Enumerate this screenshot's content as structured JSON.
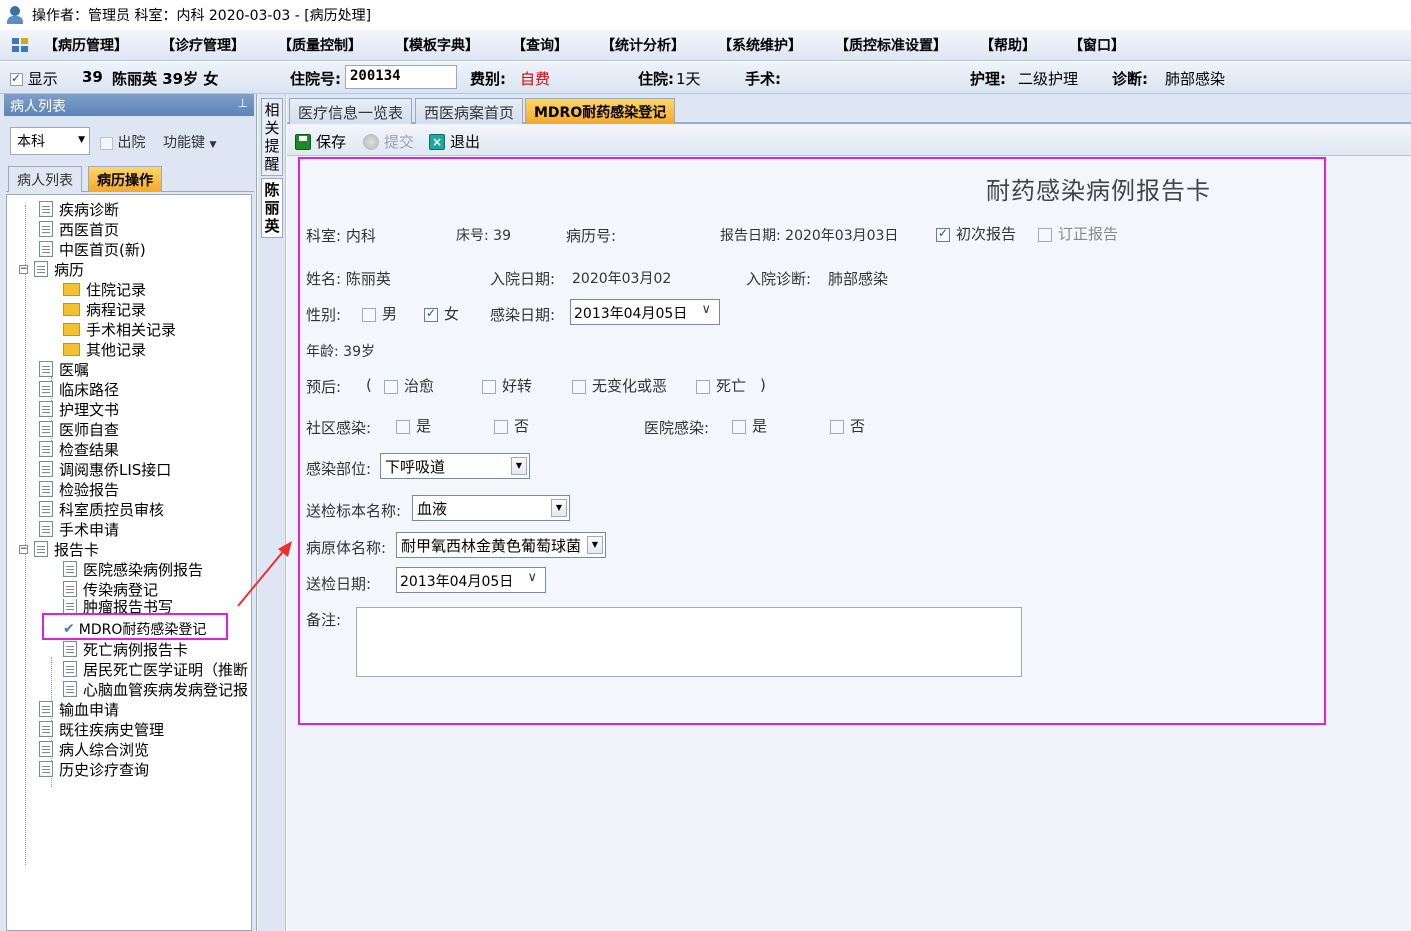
{
  "window": {
    "title": "操作者：管理员  科室：内科  2020-03-03 - [病历处理]"
  },
  "menu": {
    "items": [
      "【病历管理】",
      "【诊疗管理】",
      "【质量控制】",
      "【模板字典】",
      "【查询】",
      "【统计分析】",
      "【系统维护】",
      "【质控标准设置】",
      "【帮助】",
      "【窗口】"
    ]
  },
  "patient_bar": {
    "show_label": "显示",
    "bed": "39",
    "name_age_sex": "陈丽英  39岁  女",
    "hosp_no_label": "住院号:",
    "hosp_no": "200134",
    "fee_type_label": "费别:",
    "fee_type": "自费",
    "stay_label": "住院:",
    "stay_value": "1天",
    "surgery_label": "手术:",
    "nursing_label": "护理:",
    "nursing_value": "二级护理",
    "diagnosis_label": "诊断:",
    "diagnosis_value": "肺部感染"
  },
  "left_panel": {
    "header": "病人列表",
    "pin": "⊥",
    "dept": "本科",
    "discharge_label": "出院",
    "funckey_label": "功能键",
    "tabs": [
      "病人列表",
      "病历操作"
    ],
    "tree": [
      "疾病诊断",
      "西医首页",
      "中医首页(新)",
      "病历",
      "住院记录",
      "病程记录",
      "手术相关记录",
      "其他记录",
      "医嘱",
      "临床路径",
      "护理文书",
      "医师自查",
      "检查结果",
      "调阅惠侨LIS接口",
      "检验报告",
      "科室质控员审核",
      "手术申请",
      "报告卡",
      "医院感染病例报告",
      "传染病登记",
      "肿瘤报告书写",
      "MDRO耐药感染登记",
      "死亡病例报告卡",
      "居民死亡医学证明（推断",
      "心脑血管疾病发病登记报",
      "输血申请",
      "既往疾病史管理",
      "病人综合浏览",
      "历史诊疗查询"
    ]
  },
  "side_tabs": [
    "相关提醒",
    "陈丽英"
  ],
  "main_tabs": [
    "医疗信息一览表",
    "西医病案首页",
    "MDRO耐药感染登记"
  ],
  "toolbar": {
    "save": "保存",
    "submit": "提交",
    "exit": "退出"
  },
  "form": {
    "title": "耐药感染病例报告卡",
    "dept": "科室: 内科",
    "bed": "床号: 39",
    "record_no": "病历号:",
    "report_date": "报告日期: 2020年03月03日",
    "first_report": "初次报告",
    "revise_report": "订正报告",
    "name": "姓名: 陈丽英",
    "admit_date_label": "入院日期:",
    "admit_date": "2020年03月02",
    "admit_diag_label": "入院诊断:",
    "admit_diag": "肺部感染",
    "sex_label": "性别:",
    "male": "男",
    "female": "女",
    "infect_date_label": "感染日期:",
    "infect_date": "2013年04月05日",
    "age": "年龄: 39岁",
    "prognosis_label": "预后:",
    "paren_open": "(",
    "paren_close": ")",
    "prognosis": [
      "治愈",
      "好转",
      "无变化或恶",
      "死亡"
    ],
    "community_label": "社区感染:",
    "hospital_label": "医院感染:",
    "yes": "是",
    "no": "否",
    "site_label": "感染部位:",
    "site": "下呼吸道",
    "specimen_label": "送检标本名称:",
    "specimen": "血液",
    "pathogen_label": "病原体名称:",
    "pathogen": "耐甲氧西林金黄色葡萄球菌",
    "send_date_label": "送检日期:",
    "send_date": "2013年04月05日",
    "remark_label": "备注:"
  }
}
